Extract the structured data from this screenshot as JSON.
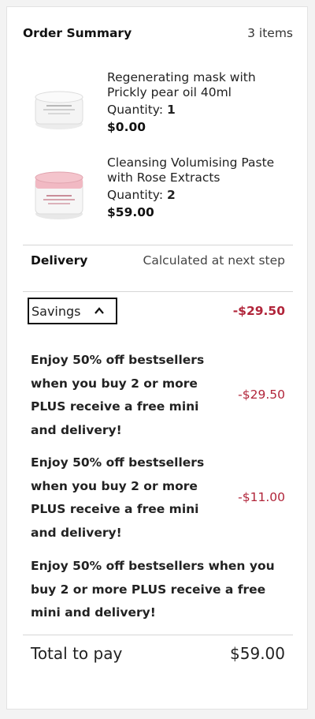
{
  "summary": {
    "title": "Order Summary",
    "count": "3 items"
  },
  "items": [
    {
      "name": "Regenerating mask with Prickly pear oil 40ml",
      "quantity_label": "Quantity:",
      "quantity": "1",
      "price": "$0.00",
      "image_icon": "white-jar-product-image"
    },
    {
      "name": "Cleansing Volumising Paste with Rose Extracts",
      "quantity_label": "Quantity:",
      "quantity": "2",
      "price": "$59.00",
      "image_icon": "pink-jar-product-image"
    }
  ],
  "delivery": {
    "label": "Delivery",
    "value": "Calculated at next step"
  },
  "savings": {
    "label": "Savings",
    "total": "-$29.50",
    "expanded": true,
    "toggle_icon": "chevron-up-icon",
    "promos": [
      {
        "text": "Enjoy 50% off bestsellers when you buy 2 or more PLUS receive a free mini and delivery!",
        "amount": "-$29.50"
      },
      {
        "text": "Enjoy 50% off bestsellers when you buy 2 or more PLUS receive a free mini and delivery!",
        "amount": "-$11.00"
      },
      {
        "text": "Enjoy 50% off bestsellers when you buy 2 or more PLUS receive a free mini and delivery!",
        "amount": ""
      }
    ]
  },
  "total": {
    "label": "Total to pay",
    "value": "$59.00"
  },
  "colors": {
    "accent_red": "#b1253a",
    "border": "#d6d6d6",
    "button_border": "#111111"
  }
}
